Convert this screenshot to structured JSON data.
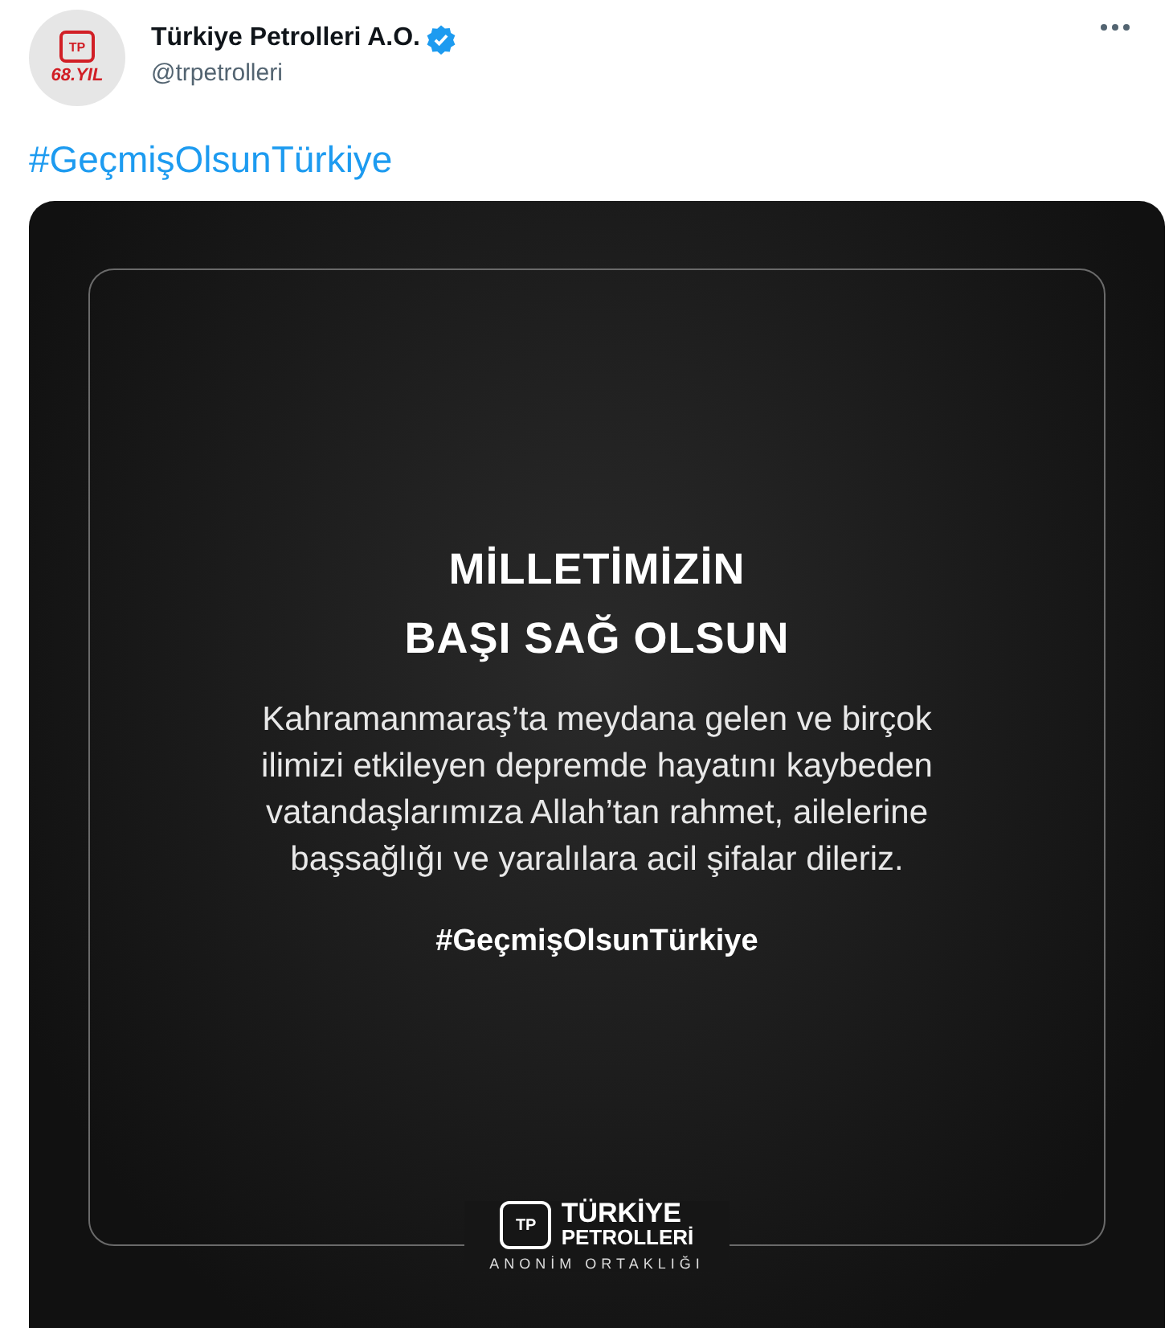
{
  "author": {
    "avatar_logo": {
      "mark": "TP",
      "caption": "68.YIL"
    },
    "name": "Türkiye Petrolleri A.O.",
    "verified": true,
    "handle": "@trpetrolleri"
  },
  "tweet_text": "#GeçmişOlsunTürkiye",
  "image": {
    "headline": [
      "MİLLETİMİZİN",
      "BAŞI SAĞ OLSUN"
    ],
    "body": "Kahramanmaraş’ta meydana gelen ve birçok ilimizi etkileyen depremde hayatını kaybeden vatandaşlarımıza Allah’tan rahmet, ailelerine başsağlığı ve yaralılara acil şifalar dileriz.",
    "hashtag": "#GeçmişOlsunTürkiye",
    "logo": {
      "mark": "TP",
      "name_lines": [
        "TÜRKİYE",
        "PETROLLERİ"
      ],
      "subtitle": "ANONİM ORTAKLIĞI"
    }
  }
}
